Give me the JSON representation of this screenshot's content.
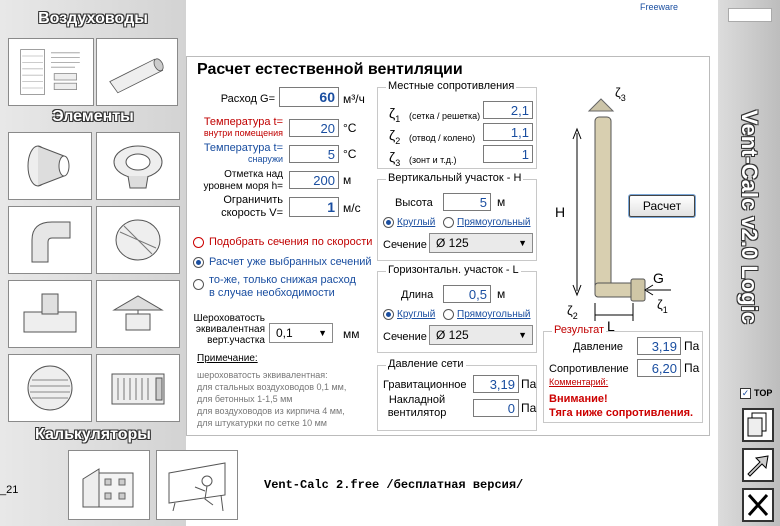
{
  "freeware": "Freeware",
  "top_label": "TOP",
  "sidebar": {
    "ducts": "Воздуховоды",
    "elements": "Элементы",
    "calcs": "Калькуляторы"
  },
  "vertical_title": "Vent-Calc v2.0 Logic",
  "footer_text": "Vent-Calc 2.free /бесплатная версия/",
  "bottom_left_fragment": "_21",
  "main": {
    "title": "Расчет естественной вентиляции",
    "flow_label": "Расход G=",
    "flow_value": "60",
    "flow_unit": "м³/ч",
    "temp_in_label": "Температура t=",
    "temp_in_sub": "внутри помещения",
    "temp_in_value": "20",
    "temp_unit": "°C",
    "temp_out_label": "Температура t=",
    "temp_out_sub": "снаружи",
    "temp_out_value": "5",
    "altitude_label1": "Отметка над",
    "altitude_label2": "уровнем моря h=",
    "altitude_value": "200",
    "altitude_unit": "м",
    "speed_label1": "Ограничить",
    "speed_label2": "скорость V=",
    "speed_value": "1",
    "speed_unit": "м/с",
    "opt1": "Подобрать сечения по скорости",
    "opt2": "Расчет уже выбранных сечений",
    "opt3a": "то-же, только снижая расход",
    "opt3b": "в случае необходимости",
    "rough_l1": "Шероховатость",
    "rough_l2": "эквивалентная",
    "rough_l3": "верт.участка",
    "rough_value": "0,1",
    "rough_unit": "мм",
    "note_title": "Примечание:",
    "note1": "шероховатость эквивалентная:",
    "note2": "для стальных воздуховодов 0,1 мм,",
    "note3": "для бетонных 1-1,5 мм",
    "note4": "для воздуховодов из кирпича 4 мм,",
    "note5": "для штукатурки по сетке 10 мм"
  },
  "local": {
    "title": "Местные сопротивления",
    "z": "ζ",
    "z1_sub": "1",
    "z1_text": "(сетка / решетка)",
    "z1_value": "2,1",
    "z2_sub": "2",
    "z2_text": "(отвод / колено)",
    "z2_value": "1,1",
    "z3_sub": "3",
    "z3_text": "(зонт и т.д.)",
    "z3_value": "1"
  },
  "vert": {
    "title": "Вертикальный участок - Н",
    "height_label": "Высота",
    "height_value": "5",
    "height_unit": "м",
    "round": "Круглый",
    "rect": "Прямоугольный",
    "section_label": "Сечение",
    "section_value": "Ø 125"
  },
  "horiz": {
    "title": "Горизонтальн. участок - L",
    "length_label": "Длина",
    "length_value": "0,5",
    "length_unit": "м",
    "round": "Круглый",
    "rect": "Прямоугольный",
    "section_label": "Сечение",
    "section_value": "Ø 125"
  },
  "pressure": {
    "title": "Давление сети",
    "grav_label": "Гравитационное",
    "grav_value": "3,19",
    "unit": "Па",
    "fan_label1": "Накладной",
    "fan_label2": "вентилятор",
    "fan_value": "0"
  },
  "diagram": {
    "H": "H",
    "L": "L",
    "G": "G",
    "z": "ζ",
    "s1": "1",
    "s2": "2",
    "s3": "3"
  },
  "calc_button": "Расчет",
  "result": {
    "title": "Результат",
    "pressure_label": "Давление",
    "pressure_value": "3,19",
    "resist_label": "Сопротивление",
    "resist_value": "6,20",
    "unit": "Па",
    "comment_label": "Комментарий:",
    "warning1": "Внимание!",
    "warning2": "Тяга ниже сопротивления."
  },
  "colors": {
    "accent": "#1a4ea0",
    "warning": "#cc0000"
  }
}
